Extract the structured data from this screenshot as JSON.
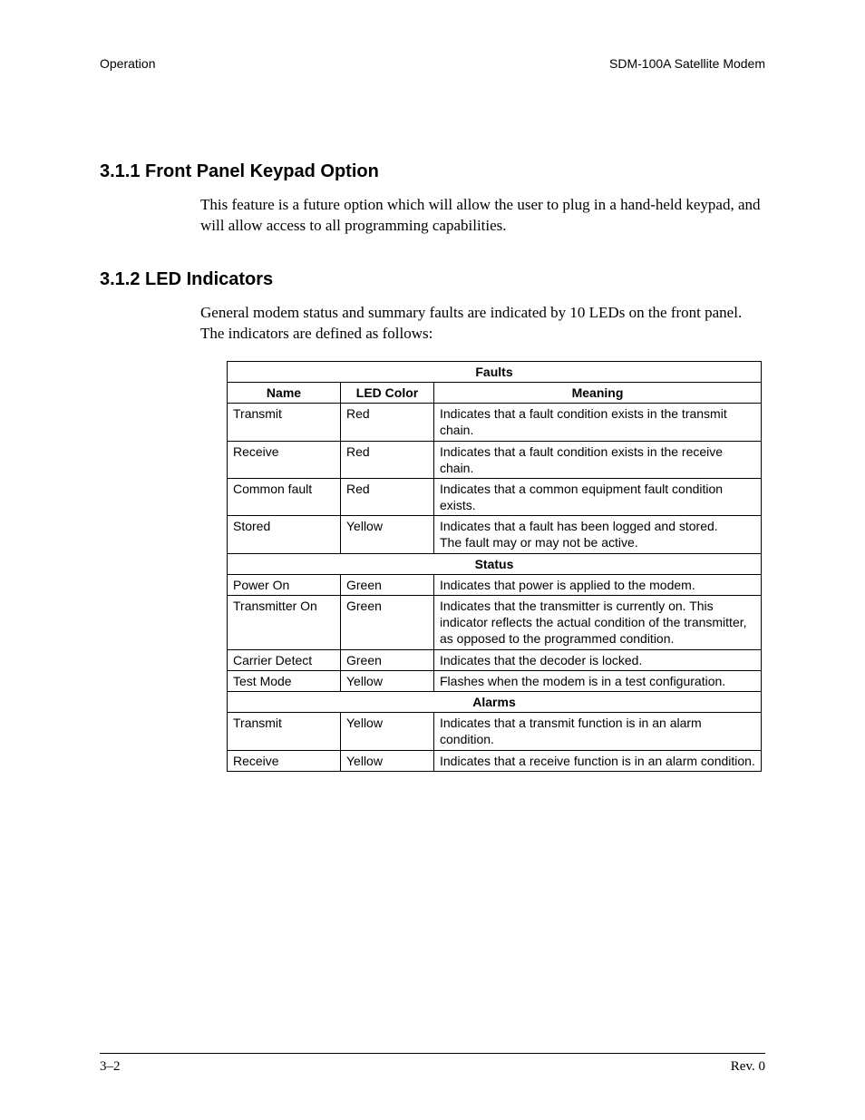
{
  "header": {
    "left": "Operation",
    "right": "SDM-100A Satellite Modem"
  },
  "sections": {
    "s1": {
      "heading": "3.1.1  Front Panel Keypad Option",
      "body": "This feature is a future option which will allow the user to plug in a hand-held keypad, and will allow access to all programming capabilities."
    },
    "s2": {
      "heading": "3.1.2  LED Indicators",
      "body": "General modem status and summary faults are indicated by 10 LEDs on the front panel. The indicators are defined as follows:"
    }
  },
  "table": {
    "group_faults": "Faults",
    "group_status": "Status",
    "group_alarms": "Alarms",
    "col_name": "Name",
    "col_color": "LED Color",
    "col_meaning": "Meaning",
    "faults": [
      {
        "name": "Transmit",
        "color": "Red",
        "meaning": "Indicates that a fault condition exists in the transmit chain."
      },
      {
        "name": "Receive",
        "color": "Red",
        "meaning": "Indicates that a fault condition exists in the receive chain."
      },
      {
        "name": "Common fault",
        "color": "Red",
        "meaning": "Indicates that a common equipment fault condition exists."
      },
      {
        "name": "Stored",
        "color": "Yellow",
        "meaning": "Indicates that a fault has been logged and stored.\nThe fault may or may not be active."
      }
    ],
    "status": [
      {
        "name": "Power On",
        "color": "Green",
        "meaning": "Indicates that power is applied to the modem."
      },
      {
        "name": "Transmitter On",
        "color": "Green",
        "meaning": "Indicates that the transmitter is currently on. This indicator reflects the actual condition of the transmitter, as opposed to the programmed condition."
      },
      {
        "name": "Carrier Detect",
        "color": "Green",
        "meaning": "Indicates that the decoder is locked."
      },
      {
        "name": "Test Mode",
        "color": "Yellow",
        "meaning": "Flashes when the modem is in a test configuration."
      }
    ],
    "alarms": [
      {
        "name": "Transmit",
        "color": "Yellow",
        "meaning": "Indicates that a transmit function is in an alarm condition."
      },
      {
        "name": "Receive",
        "color": "Yellow",
        "meaning": "Indicates that a receive function is in an alarm condition."
      }
    ]
  },
  "footer": {
    "left": "3–2",
    "right": "Rev. 0"
  }
}
